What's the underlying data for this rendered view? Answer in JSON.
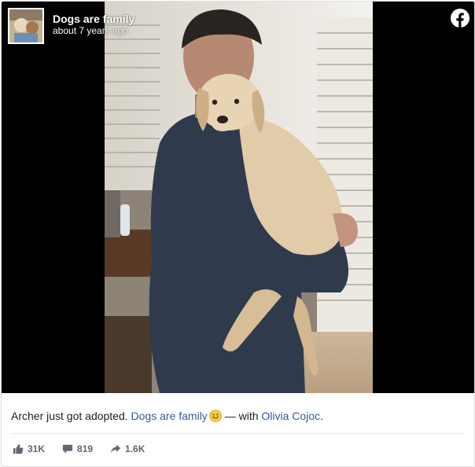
{
  "page": {
    "name": "Dogs are family",
    "time": "about 7 years ago"
  },
  "caption": {
    "text": "Archer just got adopted. ",
    "page_link": "Dogs are family",
    "with_prefix": " — with ",
    "tagged_person": "Olivia Cojoc",
    "suffix": "."
  },
  "stats": {
    "likes": "31K",
    "comments": "819",
    "shares": "1.6K"
  },
  "icons": {
    "brand": "facebook-icon",
    "like": "thumbs-up-icon",
    "comment": "comment-icon",
    "share": "share-arrow-icon",
    "emoji": "smiley-emoji-icon"
  },
  "colors": {
    "link": "#385898",
    "brand": "#ffffff",
    "stat_text": "#606770"
  }
}
